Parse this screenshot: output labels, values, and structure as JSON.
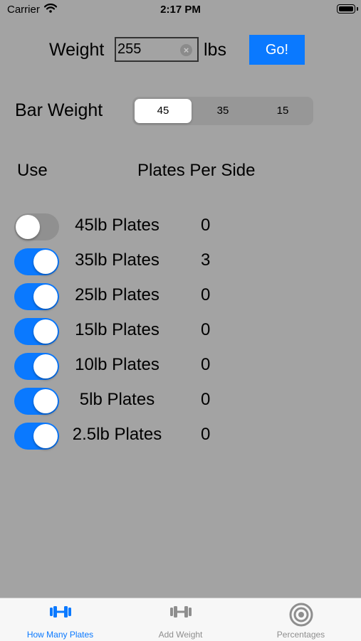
{
  "status_bar": {
    "carrier": "Carrier",
    "time": "2:17 PM"
  },
  "weight": {
    "label": "Weight",
    "value": "255",
    "unit": "lbs",
    "go_label": "Go!"
  },
  "bar_weight": {
    "label": "Bar Weight",
    "options": [
      "45",
      "35",
      "15"
    ],
    "selected": "45"
  },
  "columns": {
    "use": "Use",
    "plates_per_side": "Plates Per Side"
  },
  "plates": [
    {
      "label": "45lb Plates",
      "enabled": false,
      "count": "0"
    },
    {
      "label": "35lb Plates",
      "enabled": true,
      "count": "3"
    },
    {
      "label": "25lb Plates",
      "enabled": true,
      "count": "0"
    },
    {
      "label": "15lb Plates",
      "enabled": true,
      "count": "0"
    },
    {
      "label": "10lb Plates",
      "enabled": true,
      "count": "0"
    },
    {
      "label": "5lb Plates",
      "enabled": true,
      "count": "0"
    },
    {
      "label": "2.5lb Plates",
      "enabled": true,
      "count": "0"
    }
  ],
  "tabs": [
    {
      "label": "How Many Plates",
      "icon": "barbell-icon",
      "active": true
    },
    {
      "label": "Add Weight",
      "icon": "barbell-icon",
      "active": false
    },
    {
      "label": "Percentages",
      "icon": "target-icon",
      "active": false
    }
  ],
  "colors": {
    "accent": "#0a79ff",
    "background": "#a3a3a3",
    "toggle_off": "#909090"
  }
}
